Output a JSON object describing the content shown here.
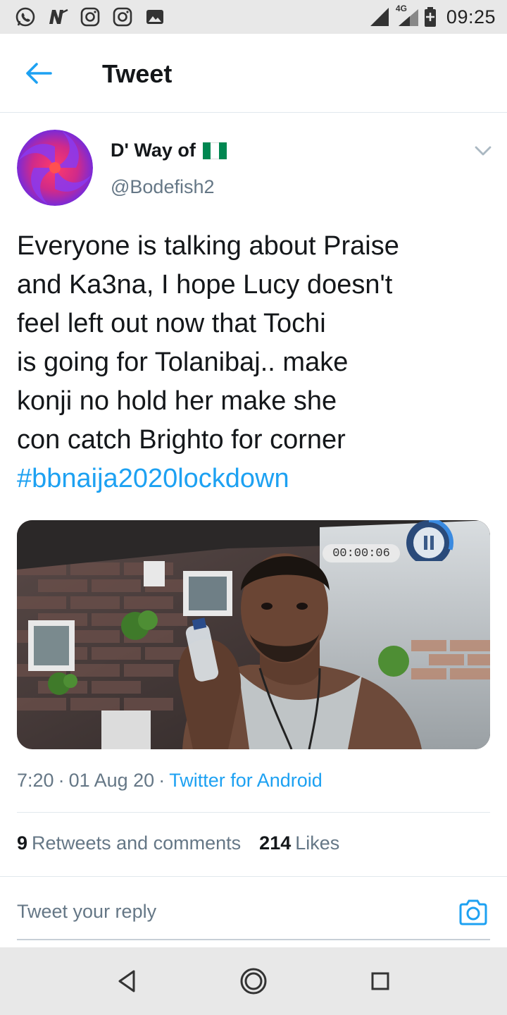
{
  "status_bar": {
    "network": "4G",
    "time": "09:25"
  },
  "header": {
    "title": "Tweet"
  },
  "tweet": {
    "display_name": "D' Way of",
    "handle": "@Bodefish2",
    "text_lines": [
      "Everyone is talking about Praise",
      "and Ka3na, I hope Lucy doesn't",
      "feel left out now that Tochi",
      "is going for Tolanibaj.. make",
      "konji no hold her make she",
      "con catch Brighto for corner"
    ],
    "hashtag": "#bbnaija2020lockdown",
    "video_time": "00:00:06",
    "time": "7:20",
    "date": "01 Aug 20",
    "source": "Twitter for Android",
    "separator": "·"
  },
  "stats": {
    "retweets_count": "9",
    "retweets_label": "Retweets and comments",
    "likes_count": "214",
    "likes_label": "Likes"
  },
  "reply": {
    "placeholder": "Tweet your reply"
  },
  "colors": {
    "accent": "#1da1f2",
    "text": "#14171a",
    "secondary": "#657786",
    "flag_green": "#008751"
  }
}
